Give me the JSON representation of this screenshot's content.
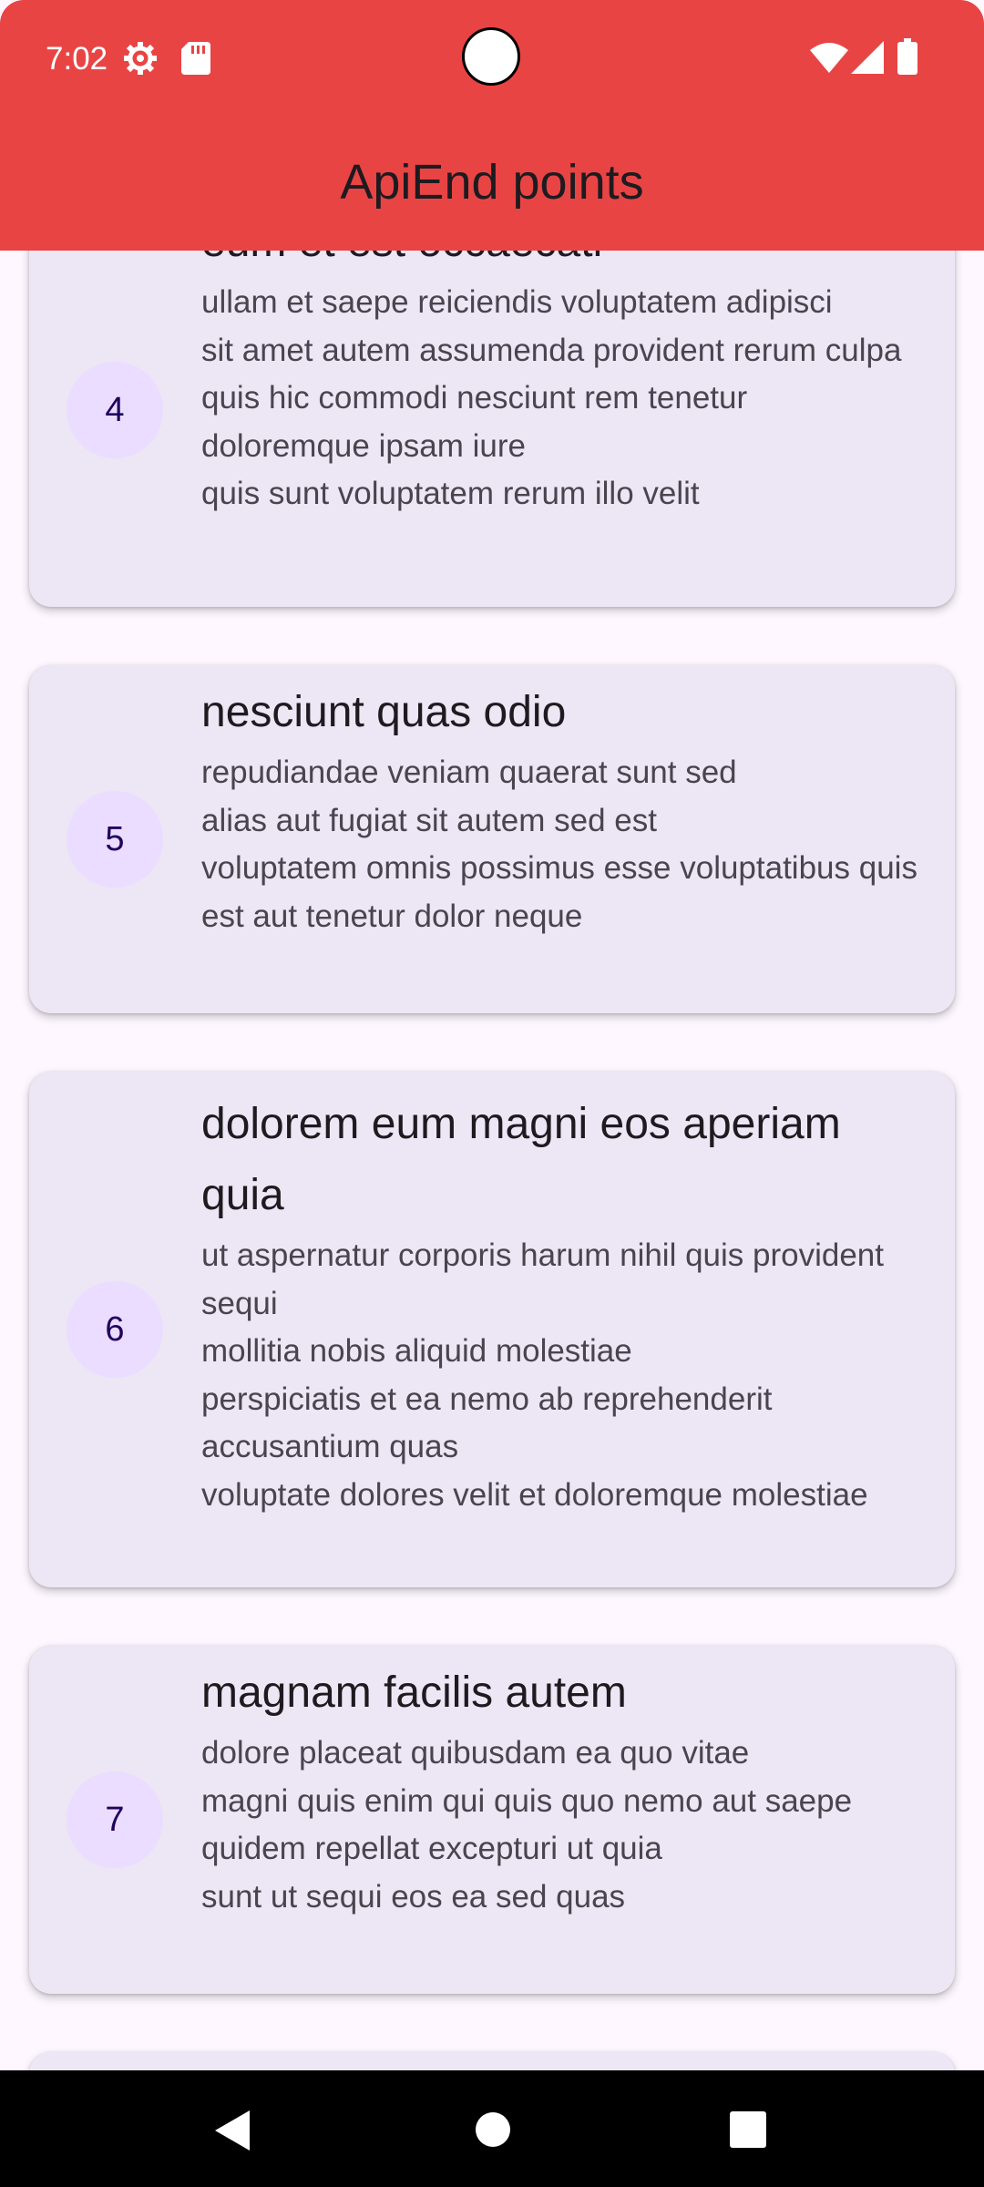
{
  "status_bar": {
    "time": "7:02",
    "icons_left": [
      "settings-gear-icon",
      "sd-card-icon"
    ],
    "icons_right": [
      "wifi-icon",
      "cell-signal-icon",
      "battery-icon"
    ],
    "background_color": "#e94444"
  },
  "app_bar": {
    "title": "ApiEnd points"
  },
  "posts": [
    {
      "id": "4",
      "title": "eum et est occaecati",
      "body": "ullam et saepe reiciendis voluptatem adipisci\nsit amet autem assumenda provident rerum culpa\nquis hic commodi nesciunt rem tenetur doloremque ipsam iure\nquis sunt voluptatem rerum illo velit"
    },
    {
      "id": "5",
      "title": "nesciunt quas odio",
      "body": "repudiandae veniam quaerat sunt sed\nalias aut fugiat sit autem sed est\nvoluptatem omnis possimus esse voluptatibus quis\nest aut tenetur dolor neque"
    },
    {
      "id": "6",
      "title": "dolorem eum magni eos aperiam quia",
      "body": "ut aspernatur corporis harum nihil quis provident sequi\nmollitia nobis aliquid molestiae\nperspiciatis et ea nemo ab reprehenderit accusantium quas\nvoluptate dolores velit et doloremque molestiae"
    },
    {
      "id": "7",
      "title": "magnam facilis autem",
      "body": "dolore placeat quibusdam ea quo vitae\nmagni quis enim qui quis quo nemo aut saepe\nquidem repellat excepturi ut quia\nsunt ut sequi eos ea sed quas"
    }
  ],
  "nav_bar": {
    "buttons": [
      "back-icon",
      "home-icon",
      "recents-icon"
    ]
  },
  "colors": {
    "card_background": "#ede6f4",
    "avatar_background": "#eaddff",
    "page_background": "#fef7ff"
  }
}
